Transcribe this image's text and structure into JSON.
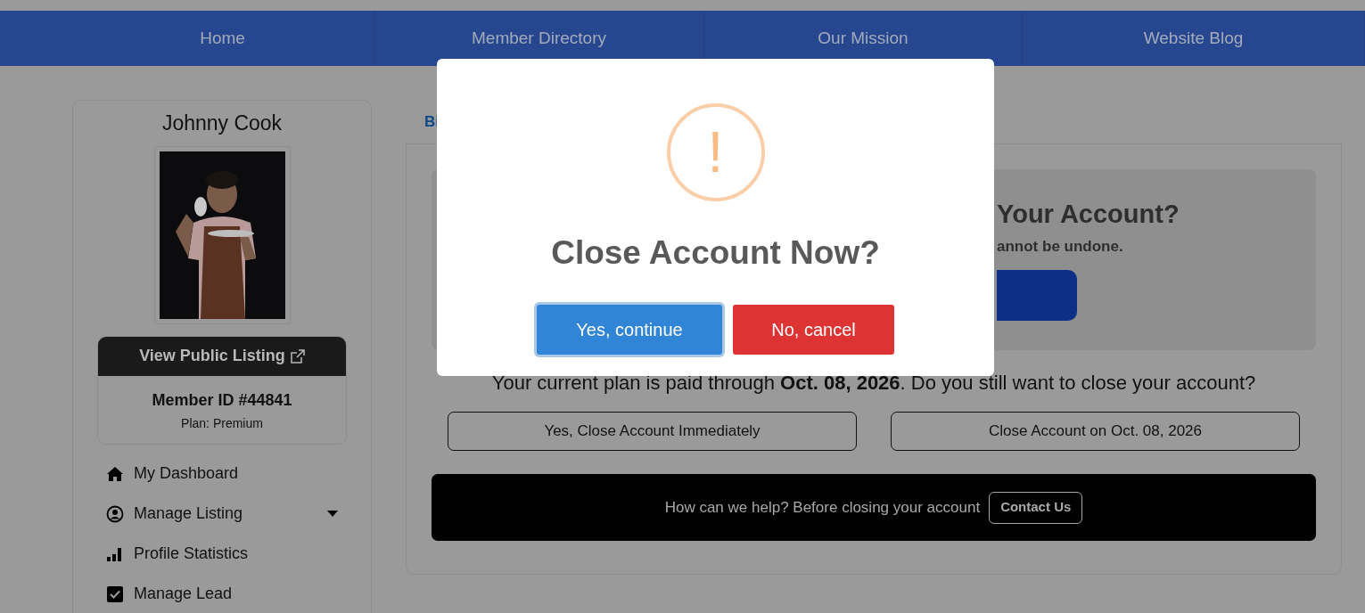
{
  "nav": [
    {
      "label": "Home"
    },
    {
      "label": "Member Directory"
    },
    {
      "label": "Our Mission"
    },
    {
      "label": "Website Blog"
    }
  ],
  "sidebar": {
    "name": "Johnny Cook",
    "listing_button": "View Public Listing",
    "member_id": "Member ID #44841",
    "plan": "Plan: Premium",
    "menu": [
      {
        "label": "My Dashboard",
        "kind": "link"
      },
      {
        "label": "Manage Listing",
        "kind": "dropdown"
      },
      {
        "label": "Profile Statistics",
        "kind": "link"
      },
      {
        "label": "Manage Lead",
        "kind": "link"
      }
    ]
  },
  "tabs": [
    {
      "label": "Bi",
      "selected": true
    }
  ],
  "close_panel": {
    "heading": "Your Account?",
    "note": "annot be undone.",
    "notice": "Your current plan is paid through **Oct. 08, 2026**. Do you still want to close your account?",
    "buttons": [
      "Yes, Close Account Immediately",
      "Close Account on Oct. 08, 2026"
    ],
    "help_text": "How can we help? Before closing your account",
    "contact_button": "Contact Us"
  },
  "modal": {
    "icon": "!",
    "title": "Close Account Now?",
    "confirm": "Yes, continue",
    "cancel": "No, cancel"
  }
}
